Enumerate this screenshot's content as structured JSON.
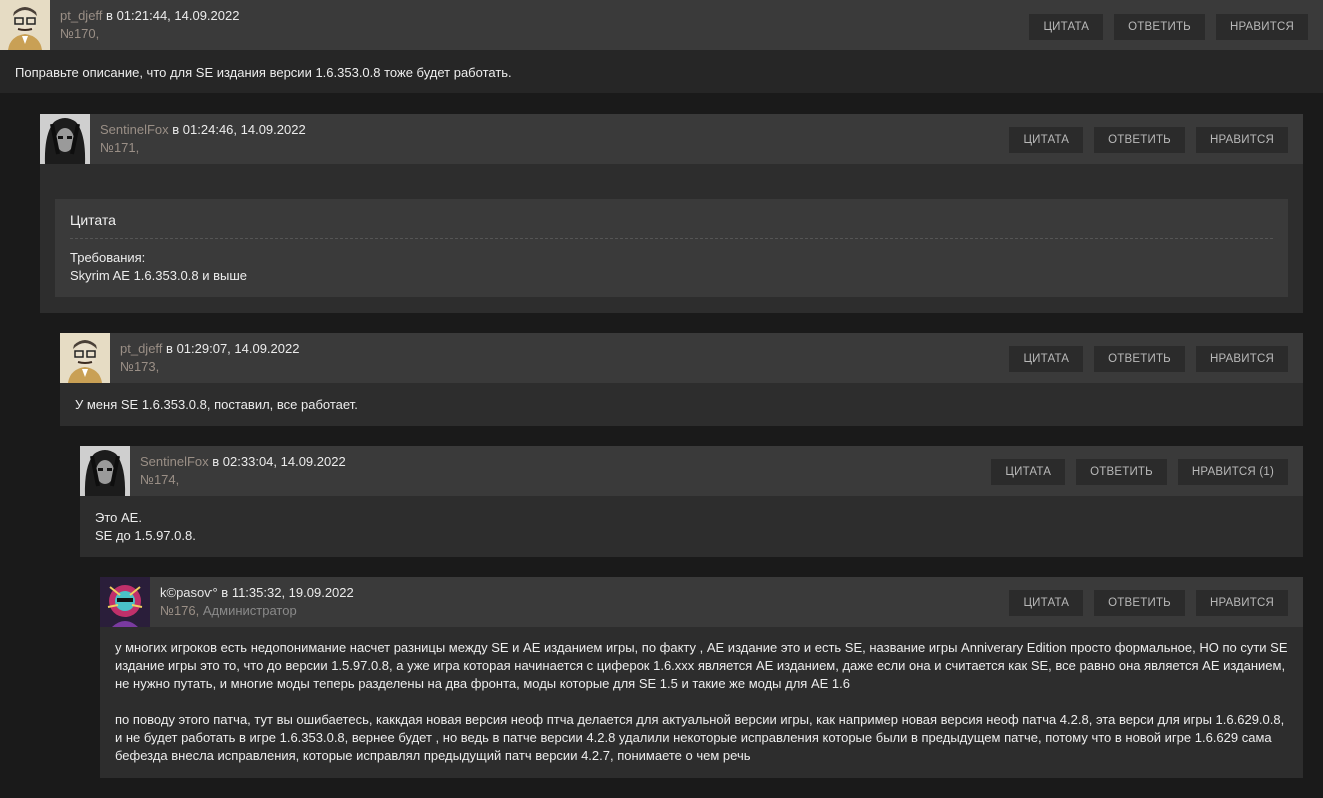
{
  "buttons": {
    "quote": "ЦИТАТА",
    "reply": "ОТВЕТИТЬ",
    "like": "НРАВИТСЯ"
  },
  "comments": [
    {
      "user": "pt_djeff",
      "date": "в 01:21:44, 14.09.2022",
      "num": "№170",
      "role": "",
      "like": "НРАВИТСЯ",
      "body": [
        "Поправьте описание, что для SE издания версии 1.6.353.0.8 тоже будет работать."
      ]
    },
    {
      "user": "SentinelFox",
      "date": "в 01:24:46, 14.09.2022",
      "num": "№171",
      "role": "",
      "like": "НРАВИТСЯ",
      "quote": {
        "title": "Цитата",
        "lines": [
          "Требования:",
          "Skyrim AE 1.6.353.0.8 и выше"
        ]
      }
    },
    {
      "user": "pt_djeff",
      "date": "в 01:29:07, 14.09.2022",
      "num": "№173",
      "role": "",
      "like": "НРАВИТСЯ",
      "body": [
        "У меня SE 1.6.353.0.8, поставил, все работает."
      ]
    },
    {
      "user": "SentinelFox",
      "date": "в 02:33:04, 14.09.2022",
      "num": "№174",
      "role": "",
      "like": "НРАВИТСЯ (1)",
      "body": [
        "Это AE.",
        "SE до 1.5.97.0.8."
      ]
    },
    {
      "user": "k©pasoѵ°",
      "date": "в 11:35:32, 19.09.2022",
      "num": "№176",
      "role": "Администратор",
      "like": "НРАВИТСЯ",
      "body": [
        "у многих игроков есть недопонимание насчет разницы между SE и AE изданием игры, по факту , AE издание это и есть SE, название игры Anniverary Edition просто формальное, НО по сути SE издание игры это то, что до версии 1.5.97.0.8, а уже игра которая начинается с циферок 1.6.xxx является AE изданием, даже если она и считается как SE, все равно она является AE изданием, не нужно путать, и многие моды теперь разделены на два фронта, моды которые для SE 1.5 и такие же моды для AE 1.6",
        "по поводу этого патча, тут вы ошибаетесь, каккдая новая версия неоф птча делается для актуальной версии игры, как например новая версия неоф патча 4.2.8, эта верси для игры 1.6.629.0.8, и не будет работать в игре 1.6.353.0.8, вернее будет , но ведь в патче версии 4.2.8 удалили некоторые исправления которые были в предыдущем патче, потому что в новой игре 1.6.629 сама бефезда внесла исправления, которые исправлял предыдущий патч версии 4.2.7, понимаете о чем речь"
      ]
    }
  ]
}
